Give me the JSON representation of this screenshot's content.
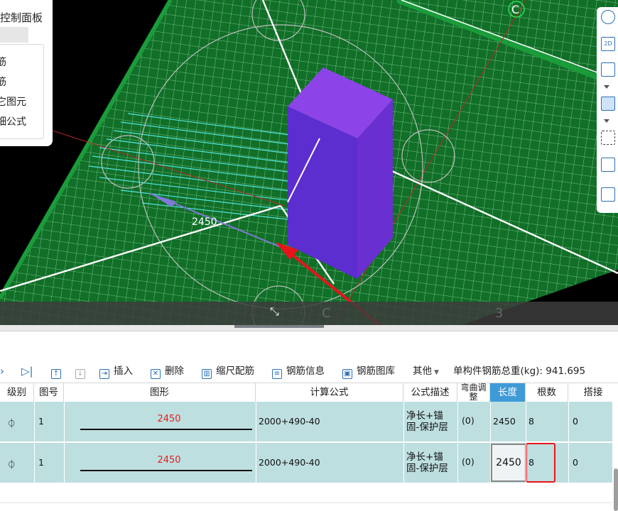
{
  "viewport": {
    "panel_title": "控制面板",
    "panel_items": [
      "筋",
      "筋",
      "它图元",
      "细公式"
    ],
    "dimension_label": "2450",
    "axis_label_c_top": "C",
    "bottom_bar_label_c": "C",
    "bottom_bar_label_3": "3",
    "colors": {
      "slab": "#116f28",
      "column": "#6a2fd1",
      "arrow": "#e8141c"
    }
  },
  "right_toolbar": {
    "view_2d_label": "2D",
    "icons": [
      "orbit-icon",
      "view-2d-icon",
      "cube-icon",
      "cube-filled-icon",
      "dashed-select-icon",
      "box-view-icon",
      "report-icon"
    ]
  },
  "toolbar": {
    "items": [
      {
        "name": "nav-next",
        "label": ""
      },
      {
        "name": "nav-last",
        "label": ""
      },
      {
        "name": "move-up",
        "label": ""
      },
      {
        "name": "move-down",
        "label": ""
      },
      {
        "name": "insert",
        "label": "插入"
      },
      {
        "name": "delete",
        "label": "删除"
      },
      {
        "name": "scale-rebar",
        "label": "缩尺配筋"
      },
      {
        "name": "rebar-info",
        "label": "钢筋信息"
      },
      {
        "name": "rebar-library",
        "label": "钢筋图库"
      },
      {
        "name": "other",
        "label": "其他"
      }
    ],
    "total_weight_label": "单构件钢筋总重(kg):",
    "total_weight_value": "941.695"
  },
  "table": {
    "headers": [
      "级别",
      "图号",
      "图形",
      "计算公式",
      "公式描述",
      "弯曲调整",
      "长度",
      "根数",
      "搭接"
    ],
    "rows": [
      {
        "grade": "⏀",
        "fig_no": "1",
        "shape_value": "2450",
        "formula": "2000+490-40",
        "desc_line1": "净长+锚",
        "desc_line2": "固-保护层",
        "bend": "(0)",
        "length": "2450",
        "count": "8",
        "lap": "0"
      },
      {
        "grade": "⏀",
        "fig_no": "1",
        "shape_value": "2450",
        "formula": "2000+490-40",
        "desc_line1": "净长+锚",
        "desc_line2": "固-保护层",
        "bend": "(0)",
        "length": "2450",
        "count": "8",
        "lap": "0"
      }
    ]
  }
}
